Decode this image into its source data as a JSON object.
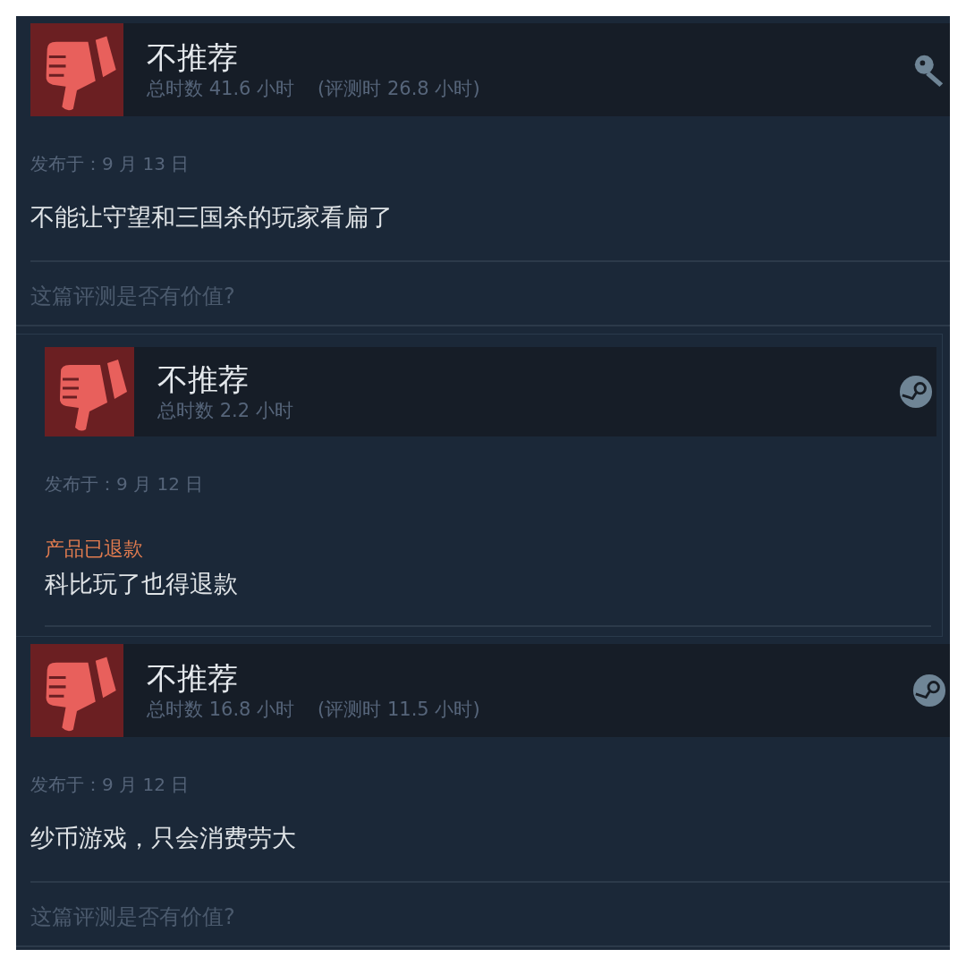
{
  "reviews": [
    {
      "framed": false,
      "kind": "key",
      "verdict": "不推荐",
      "hours": "总时数 41.6 小时",
      "review_hours": "(评测时 26.8 小时)",
      "posted": "发布于：9 月 13 日",
      "body": "不能让守望和三国杀的玩家看扁了",
      "helpful_prompt": "这篇评测是否有价值?"
    },
    {
      "framed": true,
      "kind": "steam",
      "verdict": "不推荐",
      "hours": "总时数 2.2 小时",
      "posted": "发布于：9 月 12 日",
      "refunded": "产品已退款",
      "body": "科比玩了也得退款"
    },
    {
      "framed": false,
      "kind": "steam",
      "verdict": "不推荐",
      "hours": "总时数 16.8 小时",
      "review_hours": "(评测时 11.5 小时)",
      "posted": "发布于：9 月 12 日",
      "body": "纱币游戏，只会消费劳大",
      "helpful_prompt": "这篇评测是否有价值?"
    }
  ]
}
